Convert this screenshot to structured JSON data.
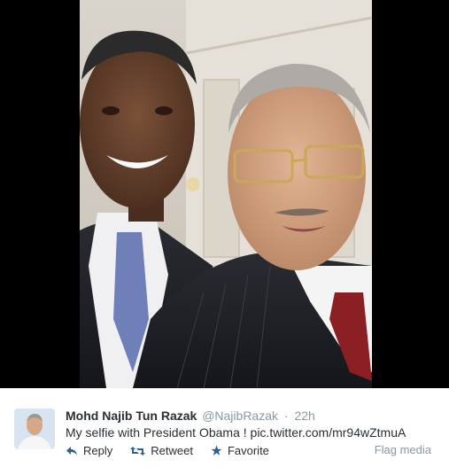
{
  "tweet": {
    "full_name": "Mohd Najib Tun Razak",
    "username": "@NajibRazak",
    "separator": "·",
    "timestamp": "22h",
    "text_prefix": "My selfie with President Obama ! ",
    "link_text": "pic.twitter.com/mr94wZtmuA"
  },
  "actions": {
    "reply_label": "Reply",
    "retweet_label": "Retweet",
    "favorite_label": "Favorite",
    "flag_label": "Flag media"
  },
  "icons": {
    "reply": "reply-arrow-icon",
    "retweet": "retweet-icon",
    "favorite": "star-icon"
  },
  "colors": {
    "name": "#292f33",
    "meta": "#8899a6",
    "action_icon": "#2a6496",
    "background": "#ffffff"
  }
}
